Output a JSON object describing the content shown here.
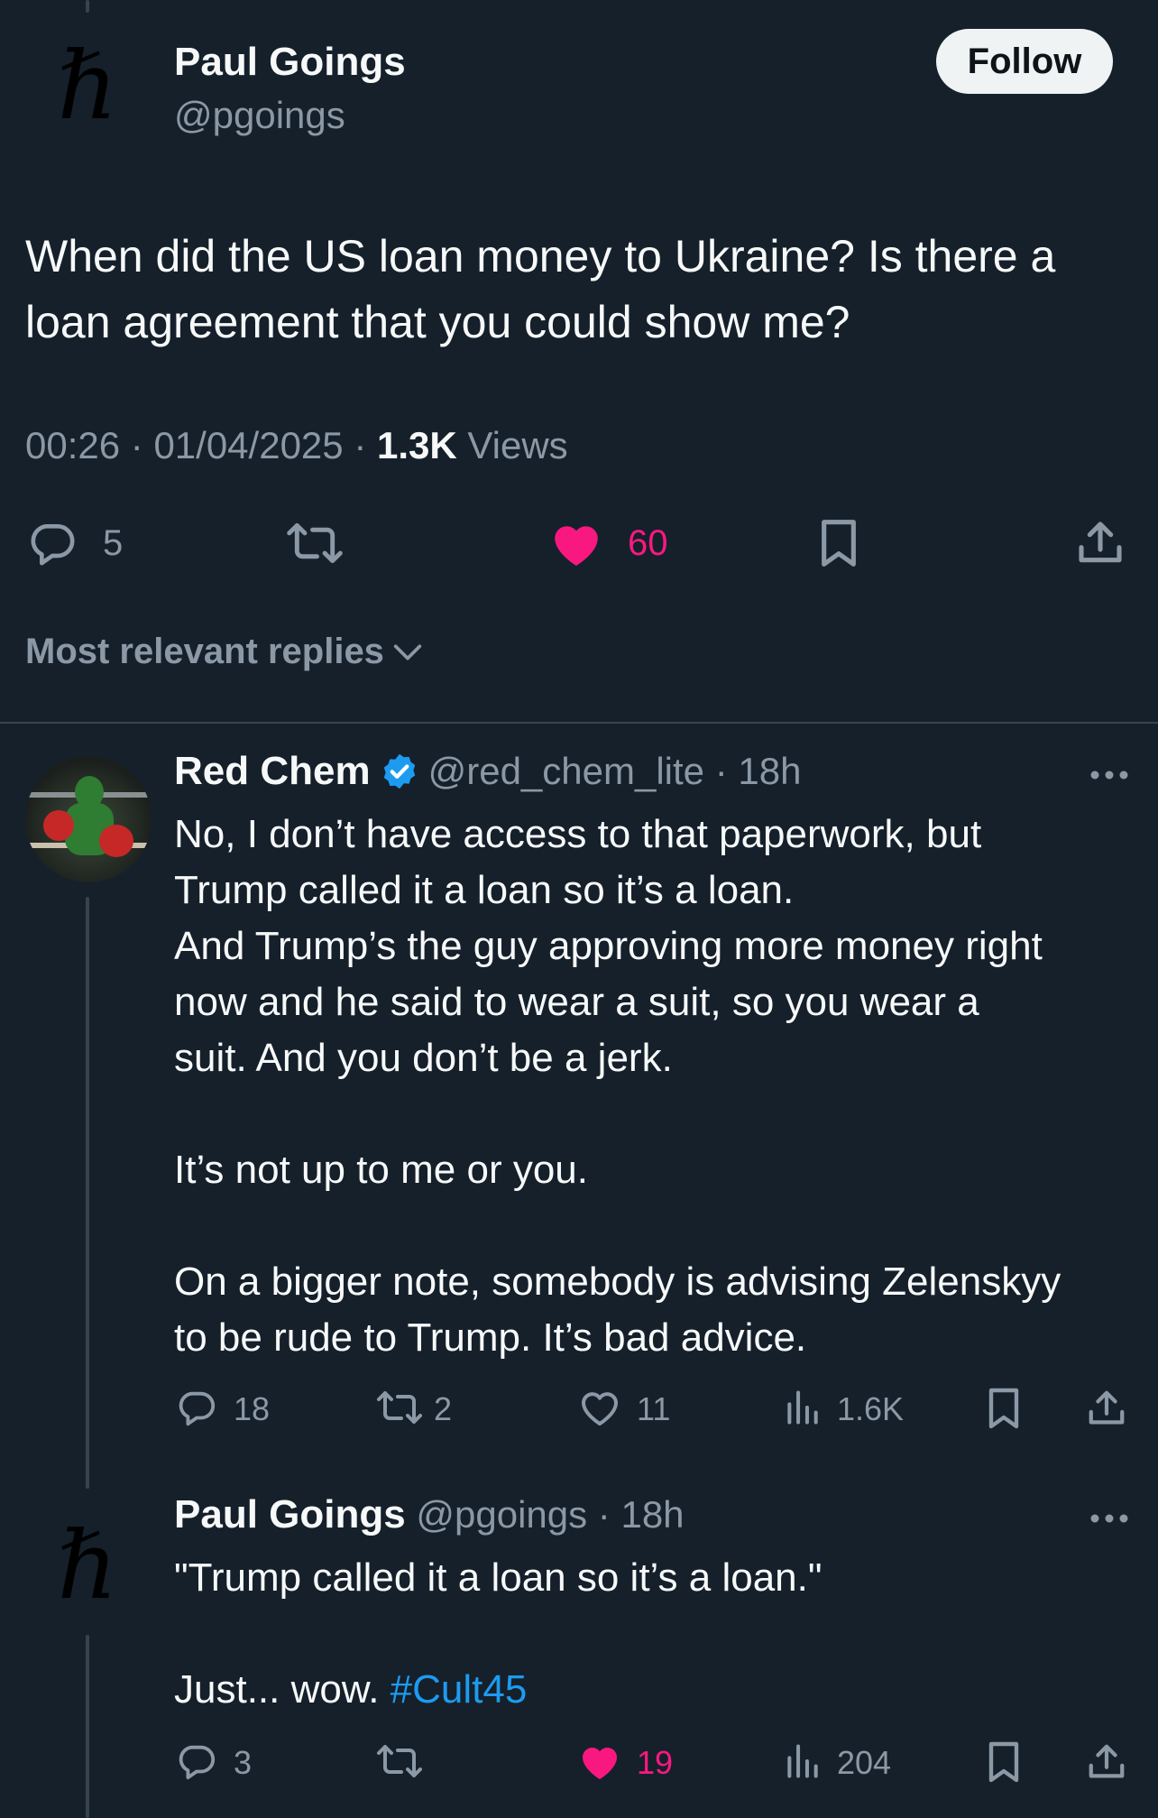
{
  "main_tweet": {
    "author_name": "Paul Goings",
    "handle": "@pgoings",
    "follow_label": "Follow",
    "avatar_glyph": "ℏ",
    "text": "When did the US loan money to Ukraine? Is there a loan agreement that you could show me?",
    "time": "00:26",
    "date": "01/04/2025",
    "views_count": "1.3K",
    "views_label": "Views",
    "reply_count": "5",
    "like_count": "60"
  },
  "sort": {
    "label": "Most relevant replies"
  },
  "reply1": {
    "author_name": "Red Chem",
    "handle": "@red_chem_lite",
    "time": "18h",
    "text_lines": [
      "No, I don’t have access to that paperwork, but",
      "Trump called it a loan so it’s a loan.",
      "And Trump’s the guy approving more money right",
      "now and he said to wear a suit, so you wear a",
      "suit. And you don’t be a jerk.",
      "",
      "It’s not up to me or you.",
      "",
      "On a bigger note, somebody is advising Zelenskyy",
      "to be rude to Trump. It’s bad advice."
    ],
    "reply_count": "18",
    "retweet_count": "2",
    "like_count": "11",
    "view_count": "1.6K"
  },
  "reply2": {
    "author_name": "Paul Goings",
    "handle": "@pgoings",
    "time": "18h",
    "avatar_glyph": "ℏ",
    "line1": "\"Trump called it a loan so it’s a loan.\"",
    "line2_text": "Just... wow. ",
    "hashtag": "#Cult45",
    "reply_count": "3",
    "like_count": "19",
    "view_count": "204"
  },
  "colors": {
    "background": "#15202b",
    "like_pink": "#f91880",
    "link_blue": "#1d9bf0",
    "verified_blue": "#1d9bf0",
    "muted": "#8b98a5"
  },
  "icons": [
    "reply-icon",
    "retweet-icon",
    "heart-icon",
    "bookmark-icon",
    "share-icon",
    "views-icon",
    "verified-icon",
    "more-icon",
    "chevron-down-icon"
  ]
}
